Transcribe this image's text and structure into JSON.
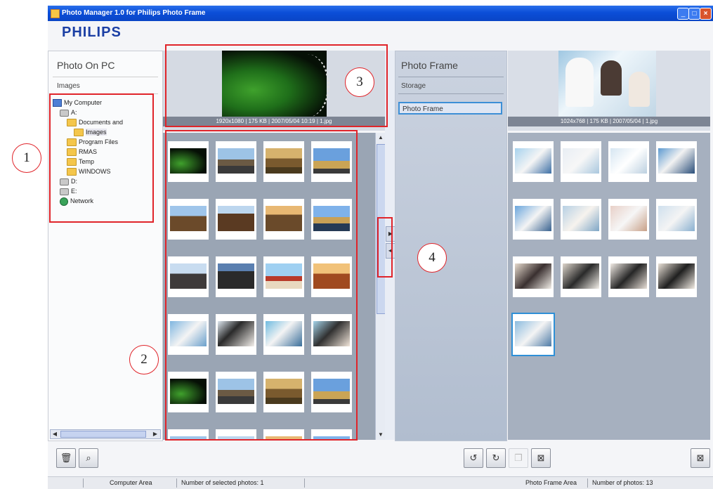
{
  "window": {
    "title": "Photo Manager 1.0 for Philips Photo Frame",
    "brand": "PHILIPS"
  },
  "pc_panel": {
    "header": "Photo On PC",
    "subheader": "Images",
    "tree": [
      {
        "label": "My Computer",
        "icon": "computer-icon",
        "depth": 0
      },
      {
        "label": "A:",
        "icon": "drive-icon",
        "depth": 1
      },
      {
        "label": "Documents and",
        "icon": "folder-icon",
        "depth": 2
      },
      {
        "label": "Images",
        "icon": "folder-icon",
        "depth": 3,
        "selected": true
      },
      {
        "label": "Program Files",
        "icon": "folder-icon",
        "depth": 2
      },
      {
        "label": "RMAS",
        "icon": "folder-icon",
        "depth": 2
      },
      {
        "label": "Temp",
        "icon": "folder-icon",
        "depth": 2
      },
      {
        "label": "WINDOWS",
        "icon": "folder-icon",
        "depth": 2
      },
      {
        "label": "D:",
        "icon": "drive-icon",
        "depth": 1
      },
      {
        "label": "E:",
        "icon": "drive-icon",
        "depth": 1
      },
      {
        "label": "Network",
        "icon": "network-icon",
        "depth": 1
      }
    ]
  },
  "pc_preview": {
    "info": "1920x1080 | 175 KB | 2007/05/04 10:19 | 1.jpg"
  },
  "frame_panel": {
    "header": "Photo Frame",
    "subheader": "Storage",
    "items": [
      "Photo Frame"
    ]
  },
  "frame_preview": {
    "info": "1024x768 | 175 KB | 2007/05/04 | 1.jpg"
  },
  "status": {
    "computer_area": "Computer Area",
    "pc_selected": "Number of selected photos: 1",
    "frame_area": "Photo Frame Area",
    "frame_count": "Number of photos: 13"
  },
  "colors": {
    "brand": "#1b3fa4",
    "annotation": "#e0242a",
    "selection": "#2e8fd6"
  },
  "annotations": [
    "1",
    "2",
    "3",
    "4"
  ]
}
